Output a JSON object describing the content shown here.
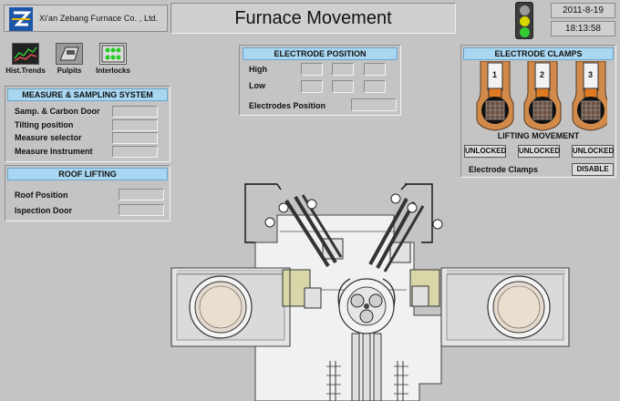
{
  "header": {
    "company": "Xi'an Zebang Furnace Co. , Ltd.",
    "title": "Furnace Movement",
    "date": "2011-8-19",
    "time": "18:13:58",
    "traffic_light_colors": [
      "#9a9a9a",
      "#d8d800",
      "#33cc33"
    ]
  },
  "toolbar": {
    "items": [
      {
        "label": "Hist.Trends",
        "icon": "trend-chart-icon"
      },
      {
        "label": "Pulpits",
        "icon": "pulpits-icon"
      },
      {
        "label": "Interlocks",
        "icon": "interlocks-icon"
      }
    ]
  },
  "measure_sampling": {
    "title": "MEASURE & SAMPLING SYSTEM",
    "rows": [
      "Samp. & Carbon Door",
      "Tilting position",
      "Measure selector",
      "Measure Instrument"
    ]
  },
  "roof_lifting": {
    "title": "ROOF LIFTING",
    "rows": [
      "Roof Position",
      "Ispection Door"
    ]
  },
  "electrode_position": {
    "title": "ELECTRODE POSITION",
    "high_label": "High",
    "low_label": "Low",
    "position_label": "Electrodes Position"
  },
  "electrode_clamps": {
    "title": "ELECTRODE CLAMPS",
    "clamp_numbers": [
      "1",
      "2",
      "3"
    ],
    "lifting_title": "LIFTING MOVEMENT",
    "lifting_status": [
      "UNLOCKED",
      "UNLOCKED",
      "UNLOCKED"
    ],
    "clamps_label": "Electrode Clamps",
    "clamps_status": "DISABLE"
  }
}
